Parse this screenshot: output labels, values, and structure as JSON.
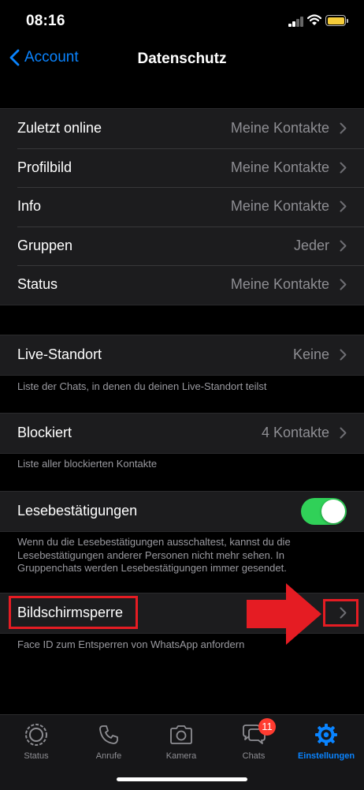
{
  "status_bar": {
    "time": "08:16"
  },
  "nav": {
    "back_label": "Account",
    "title": "Datenschutz"
  },
  "privacy_rows": [
    {
      "label": "Zuletzt online",
      "value": "Meine Kontakte"
    },
    {
      "label": "Profilbild",
      "value": "Meine Kontakte"
    },
    {
      "label": "Info",
      "value": "Meine Kontakte"
    },
    {
      "label": "Gruppen",
      "value": "Jeder"
    },
    {
      "label": "Status",
      "value": "Meine Kontakte"
    }
  ],
  "live_location": {
    "label": "Live-Standort",
    "value": "Keine",
    "footer": "Liste der Chats, in denen du deinen Live-Standort teilst"
  },
  "blocked": {
    "label": "Blockiert",
    "value": "4 Kontakte",
    "footer": "Liste aller blockierten Kontakte"
  },
  "read_receipts": {
    "label": "Lesebestätigungen",
    "enabled": true,
    "footer": "Wenn du die Lesebestätigungen ausschaltest, kannst du die Lesebestätigungen anderer Personen nicht mehr sehen. In Gruppenchats werden Lesebestätigungen immer gesendet."
  },
  "screen_lock": {
    "label": "Bildschirmsperre",
    "footer": "Face ID zum Entsperren von WhatsApp anfordern"
  },
  "tabs": [
    {
      "label": "Status",
      "icon": "status-icon"
    },
    {
      "label": "Anrufe",
      "icon": "phone-icon"
    },
    {
      "label": "Kamera",
      "icon": "camera-icon"
    },
    {
      "label": "Chats",
      "icon": "chat-bubbles-icon",
      "badge": "11"
    },
    {
      "label": "Einstellungen",
      "icon": "gear-icon",
      "active": true
    }
  ],
  "colors": {
    "accent": "#0a84ff",
    "toggle_on": "#30d158",
    "annotation_red": "#e51c23",
    "badge": "#ff3b30",
    "battery": "#f5cc3a"
  }
}
